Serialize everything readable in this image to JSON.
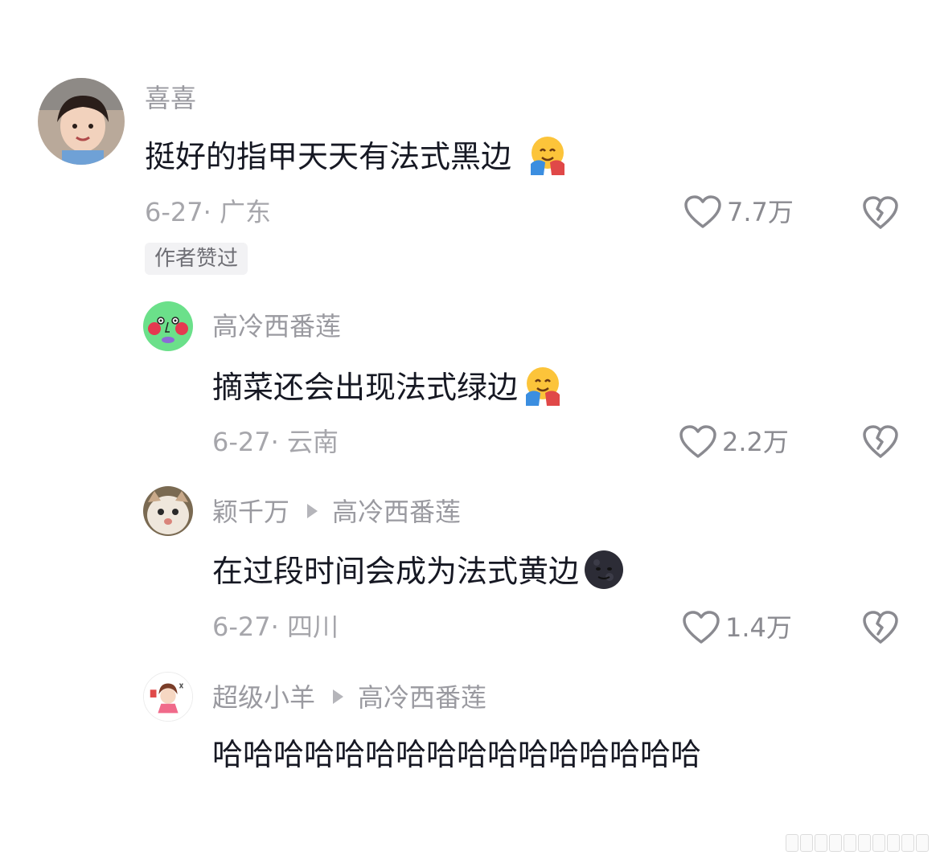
{
  "comments": [
    {
      "author": "喜喜",
      "text": "挺好的指甲天天有法式黑边",
      "emoji": "smiling-face-with-hearts-hugging-icon",
      "date_location": "6-27· 广东",
      "likes": "7.7万",
      "badge": "作者赞过"
    },
    {
      "author": "高冷西番莲",
      "text": "摘菜还会出现法式绿边",
      "emoji": "smiling-face-with-hearts-hugging-icon",
      "date_location": "6-27· 云南",
      "likes": "2.2万"
    },
    {
      "author": "颖千万",
      "reply_to": "高冷西番莲",
      "text": "在过段时间会成为法式黄边",
      "emoji": "new-moon-face-icon",
      "date_location": "6-27· 四川",
      "likes": "1.4万"
    },
    {
      "author": "超级小羊",
      "reply_to": "高冷西番莲",
      "text": "哈哈哈哈哈哈哈哈哈哈哈哈哈哈哈哈"
    }
  ],
  "colors": {
    "text": "#161823",
    "secondary": "#9a9aa0",
    "icon": "#8a8a90",
    "badge_bg": "#f2f2f4"
  }
}
